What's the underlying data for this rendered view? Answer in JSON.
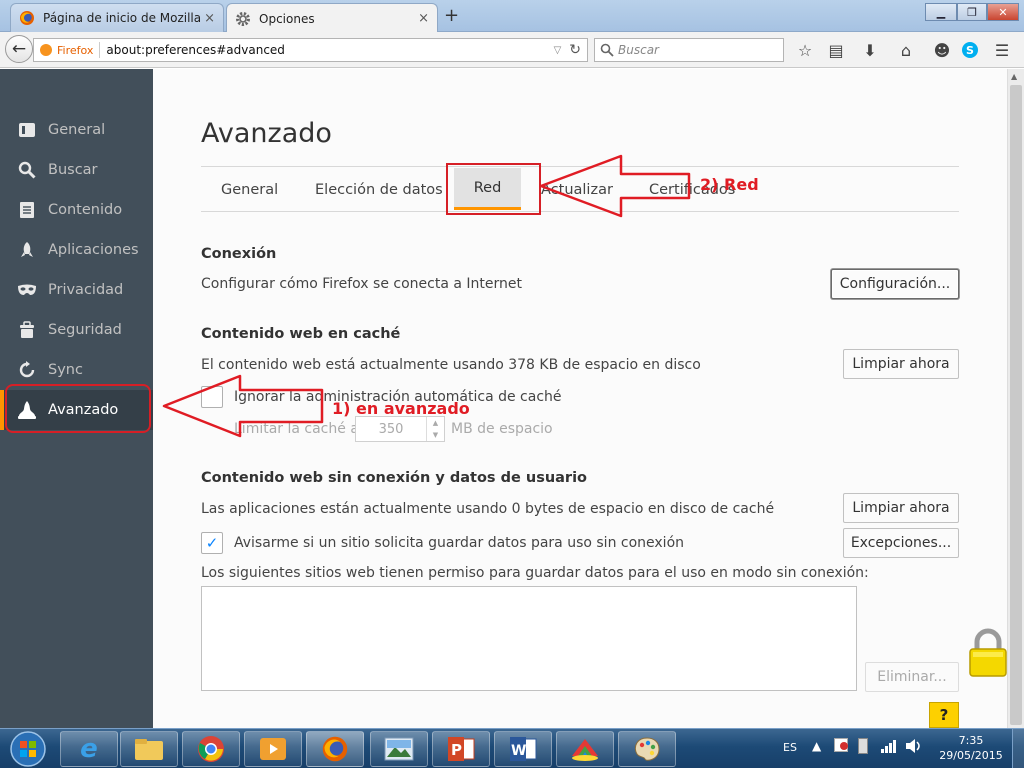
{
  "browser": {
    "tabs": [
      {
        "title": "Página de inicio de Mozilla...",
        "active": false
      },
      {
        "title": "Opciones",
        "active": true
      }
    ],
    "new_tab": "+",
    "close_tab": "×",
    "identity_label": "Firefox",
    "url": "about:preferences#advanced",
    "search_placeholder": "Buscar"
  },
  "sidebar": {
    "items": [
      {
        "label": "General",
        "icon": "general-icon"
      },
      {
        "label": "Buscar",
        "icon": "search-icon"
      },
      {
        "label": "Contenido",
        "icon": "content-icon"
      },
      {
        "label": "Aplicaciones",
        "icon": "applications-icon"
      },
      {
        "label": "Privacidad",
        "icon": "mask-icon"
      },
      {
        "label": "Seguridad",
        "icon": "security-icon"
      },
      {
        "label": "Sync",
        "icon": "sync-icon"
      },
      {
        "label": "Avanzado",
        "icon": "advanced-icon",
        "selected": true
      }
    ]
  },
  "main": {
    "title": "Avanzado",
    "tabs": [
      {
        "label": "General"
      },
      {
        "label": "Elección de datos"
      },
      {
        "label": "Red",
        "selected": true
      },
      {
        "label": "Actualizar"
      },
      {
        "label": "Certificados"
      }
    ],
    "connection": {
      "heading": "Conexión",
      "description": "Configurar cómo Firefox se conecta a Internet",
      "button": "Configuración..."
    },
    "cache": {
      "heading": "Contenido web en caché",
      "description": "El contenido web está actualmente usando 378 KB de espacio en disco",
      "button": "Limpiar ahora",
      "override_label": "Ignorar la administración automática de caché",
      "override_checked": false,
      "limit_prefix": "Limitar la caché a",
      "limit_value": "350",
      "limit_suffix": "MB de espacio"
    },
    "offline": {
      "heading": "Contenido web sin conexión y datos de usuario",
      "description": "Las aplicaciones están actualmente usando 0 bytes de espacio en disco de caché",
      "clear_button": "Limpiar ahora",
      "notify_label": "Avisarme si un sitio solicita guardar datos para uso sin conexión",
      "notify_checked": true,
      "exceptions_button": "Excepciones...",
      "list_label": "Los siguientes sitios web tienen permiso para guardar datos para el uso en modo sin conexión:",
      "remove_button": "Eliminar..."
    },
    "help_button": "?"
  },
  "annotations": {
    "step1": "1) en avanzado",
    "step2": "2) Red"
  },
  "taskbar": {
    "language": "ES",
    "time": "7:35",
    "date": "29/05/2015"
  },
  "colors": {
    "sidebar_bg": "#424f5a",
    "accent": "#ff9500",
    "annotation_red": "#e01c24"
  }
}
